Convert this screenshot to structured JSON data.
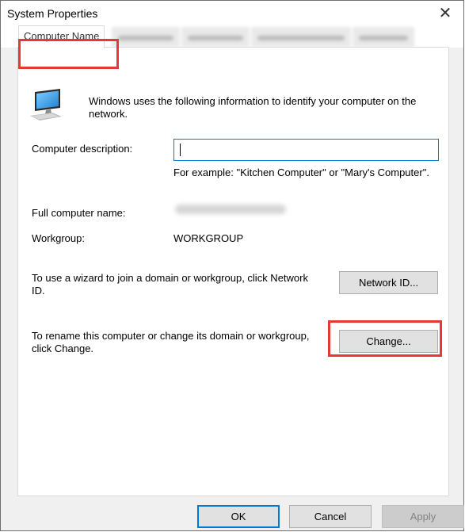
{
  "window": {
    "title": "System Properties",
    "close_glyph": "✕"
  },
  "tabs": [
    {
      "label": "Computer Name",
      "active": true
    }
  ],
  "intro": {
    "icon": "computer-monitor-icon",
    "text": "Windows uses the following information to identify your computer on the network."
  },
  "description": {
    "label": "Computer description:",
    "value": "",
    "example": "For example: \"Kitchen Computer\" or \"Mary's Computer\"."
  },
  "full_name": {
    "label": "Full computer name:"
  },
  "workgroup": {
    "label": "Workgroup:",
    "value": "WORKGROUP"
  },
  "network_id": {
    "text": "To use a wizard to join a domain or workgroup, click Network ID.",
    "button": "Network ID..."
  },
  "rename": {
    "text": "To rename this computer or change its domain or workgroup, click Change.",
    "button": "Change..."
  },
  "footer": {
    "ok": "OK",
    "cancel": "Cancel",
    "apply": "Apply"
  },
  "colors": {
    "highlight": "#e53935",
    "focus_blue": "#0078d7"
  }
}
